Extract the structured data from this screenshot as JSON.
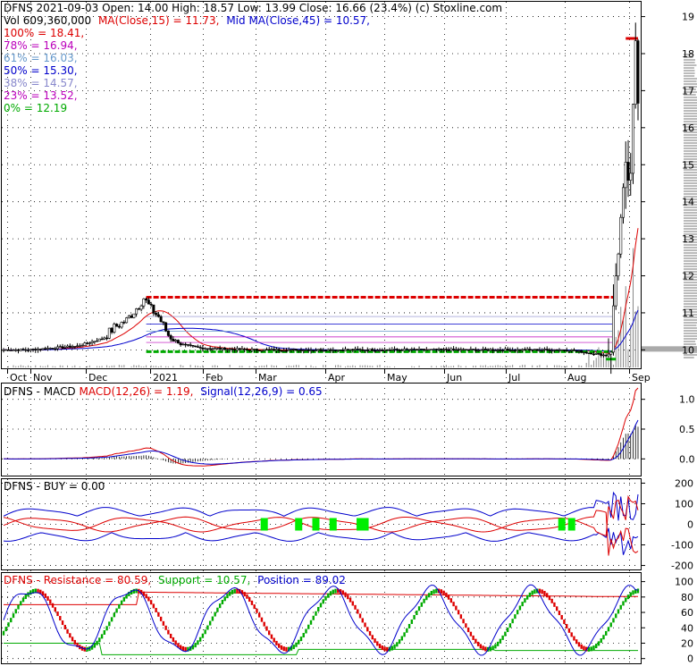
{
  "colors": {
    "red": "#dd0000",
    "blue": "#0000cc",
    "green": "#00aa00",
    "black": "#000000",
    "fib61": "#6699cc",
    "fib38": "#8888cc",
    "fib78": "#bb00bb",
    "fib23": "#bb00bb",
    "fib0": "#00aa00",
    "buy": "#00ee00"
  },
  "header": {
    "line1": "DFNS  2021-09-03 Open: 14.00  High: 18.57  Low: 13.99  Close: 16.66 (23.4%)  (c) Stoxline.com",
    "vol": "Vol 609,360,000",
    "ma15": "MA(Close,15) = 11.73,",
    "ma45": "Mid MA(Close,45) = 10.57,",
    "fib": [
      {
        "label": "100% = 18.41,",
        "color": "#dd0000"
      },
      {
        "label": "78% = 16.94,",
        "color": "#bb00bb"
      },
      {
        "label": "61% = 16.03,",
        "color": "#6699cc"
      },
      {
        "label": "50% = 15.30,",
        "color": "#0000cc"
      },
      {
        "label": "38% = 14.57,",
        "color": "#8888cc"
      },
      {
        "label": "23% = 13.52,",
        "color": "#bb00bb"
      },
      {
        "label": "0% = 12.19",
        "color": "#00aa00"
      }
    ]
  },
  "chart_data": [
    {
      "type": "candlestick",
      "name": "price",
      "x_ticks": [
        "Oct",
        "Nov",
        "Dec",
        "2021",
        "Feb",
        "Mar",
        "Apr",
        "May",
        "Jun",
        "Jul",
        "Aug",
        "Sep"
      ],
      "y_ticks": [
        10,
        11,
        12,
        13,
        14,
        15,
        16,
        17,
        18,
        19
      ],
      "ylim": [
        9.55,
        19.4
      ],
      "approx_close_path": [
        [
          0,
          10.0
        ],
        [
          10,
          10.0
        ],
        [
          20,
          10.05
        ],
        [
          30,
          10.1
        ],
        [
          40,
          10.3
        ],
        [
          45,
          10.6
        ],
        [
          50,
          10.8
        ],
        [
          55,
          11.2
        ],
        [
          57,
          11.4
        ],
        [
          60,
          11.1
        ],
        [
          63,
          10.9
        ],
        [
          67,
          10.4
        ],
        [
          72,
          10.15
        ],
        [
          80,
          10.05
        ],
        [
          100,
          10.0
        ],
        [
          180,
          10.0
        ],
        [
          230,
          10.0
        ],
        [
          245,
          9.85
        ],
        [
          247,
          10.1
        ],
        [
          249,
          12.0
        ],
        [
          251,
          13.5
        ],
        [
          253,
          14.8
        ],
        [
          255,
          14.5
        ],
        [
          257,
          18.4
        ],
        [
          258,
          16.66
        ]
      ],
      "fib_levels": [
        18.41,
        16.94,
        16.03,
        15.3,
        14.57,
        13.52,
        12.19
      ],
      "ma15_last": 11.73,
      "ma45_last": 10.57
    },
    {
      "type": "line",
      "name": "macd",
      "title": "DFNS - MACD",
      "legend": [
        "MACD(12,26) = 1.19,",
        "Signal(12,26,9) = 0.65"
      ],
      "y_ticks": [
        0.0,
        0.5,
        1.0
      ],
      "ylim": [
        -0.25,
        1.25
      ]
    },
    {
      "type": "line",
      "name": "buy",
      "title": "DFNS - BUY = 0.00",
      "y_ticks": [
        -200,
        -100,
        0,
        100,
        200
      ],
      "ylim": [
        -215,
        215
      ]
    },
    {
      "type": "line",
      "name": "position",
      "legend": [
        "DFNS - Resistance = 80.59,",
        "Support = 10.57,",
        "Position = 89.02"
      ],
      "y_ticks": [
        0,
        20,
        40,
        60,
        80,
        100
      ],
      "ylim": [
        -5,
        110
      ]
    }
  ]
}
